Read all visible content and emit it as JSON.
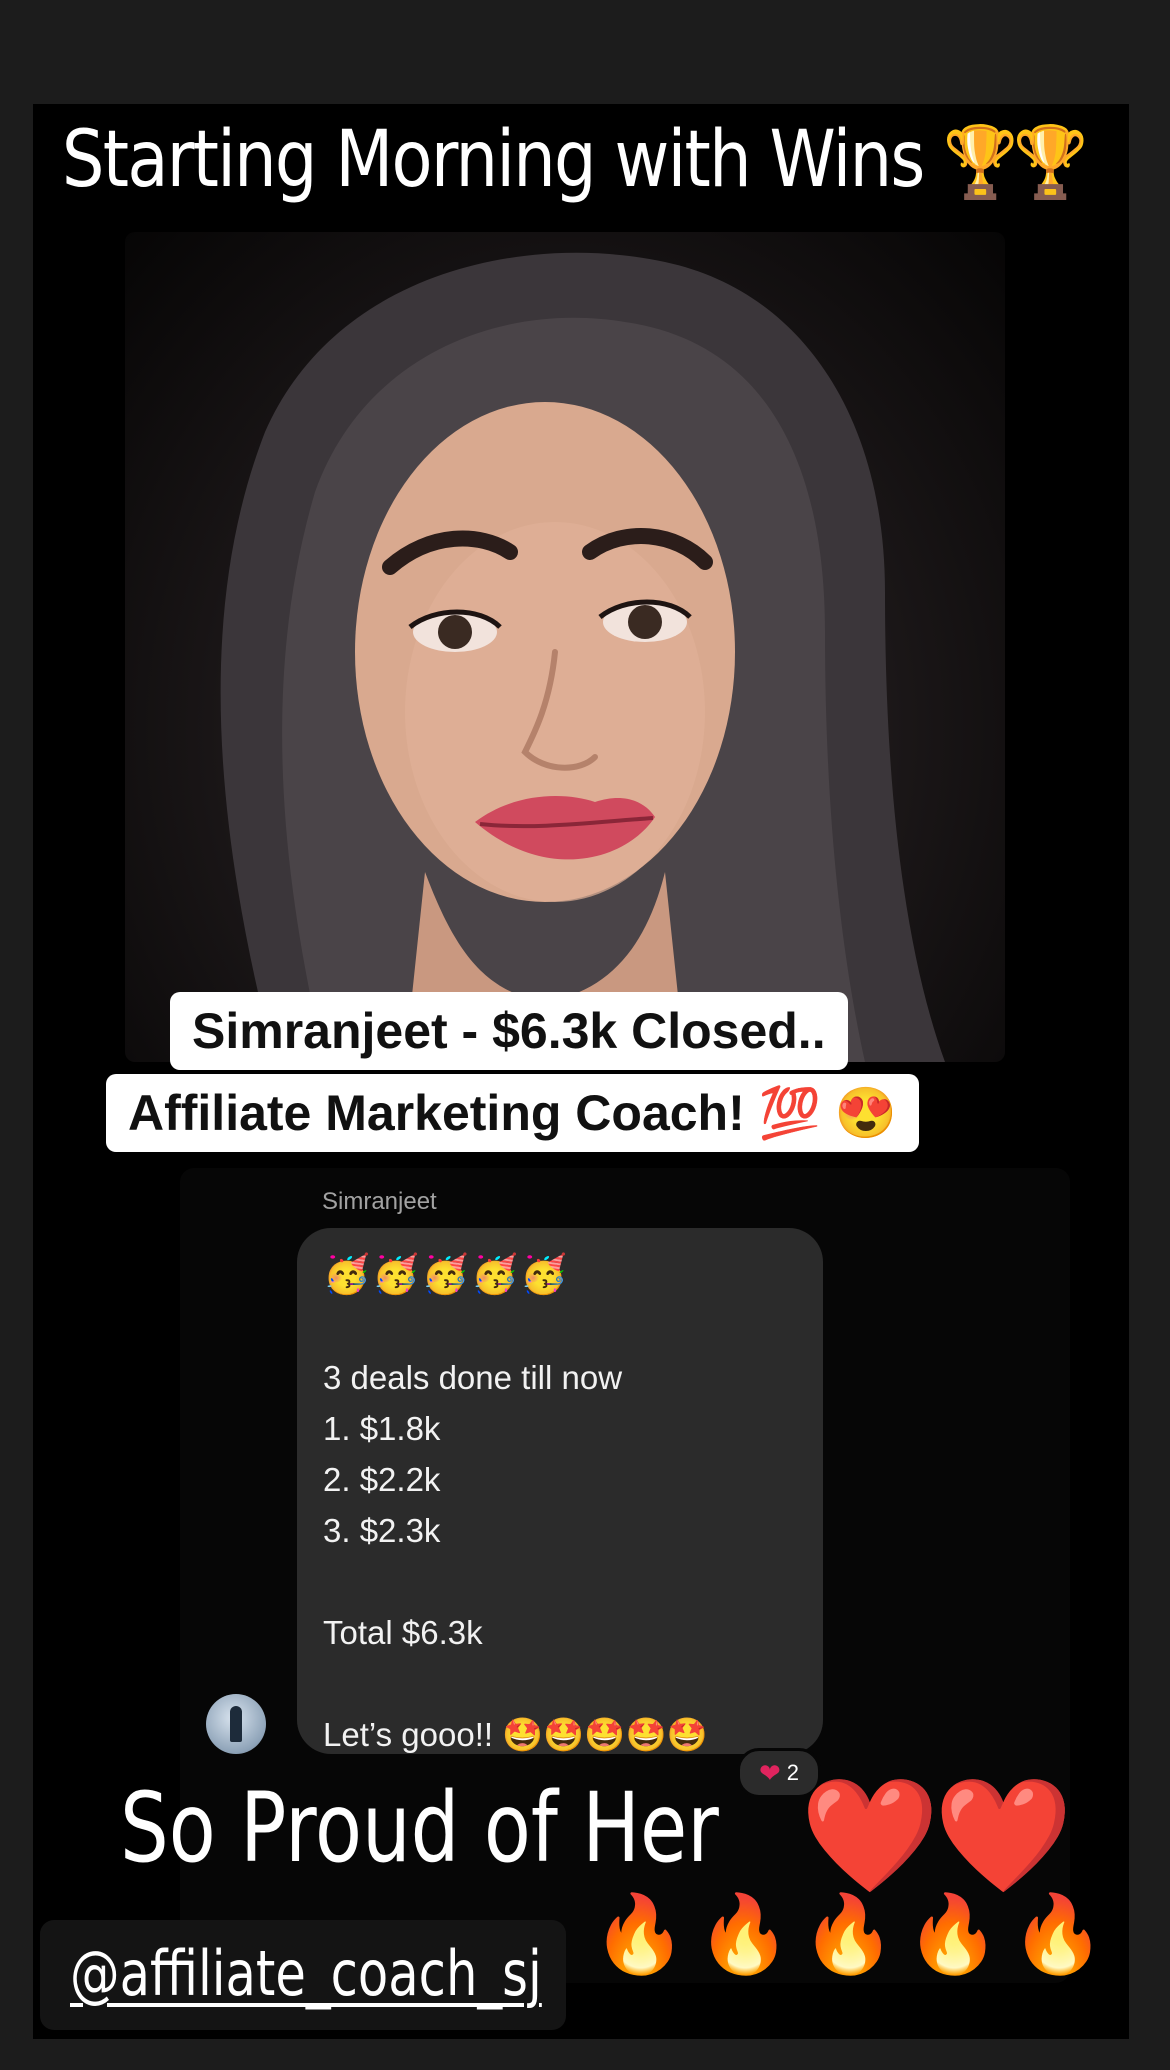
{
  "story": {
    "headline": "Starting Morning with Wins",
    "headline_emoji": "🏆🏆",
    "caption_line1": "Simranjeet - $6.3k Closed..",
    "caption_line2": "Affiliate Marketing Coach! 💯 😍",
    "footer": "So Proud of Her",
    "footer_hearts": "❤️❤️",
    "footer_fire": "🔥🔥🔥🔥🔥",
    "handle": "@affiliate_coach_sj"
  },
  "chat": {
    "sender_name": "Simranjeet",
    "message": {
      "emoji_line": "🥳🥳🥳🥳🥳",
      "intro": "3 deals done till now",
      "deals": [
        "1. $1.8k",
        "2. $2.2k",
        "3. $2.3k"
      ],
      "total": "Total $6.3k",
      "closing": "Let’s gooo!! 🤩🤩🤩🤩🤩"
    },
    "reaction": {
      "emoji": "❤",
      "count": "2"
    }
  },
  "colors": {
    "background": "#000000",
    "bubble": "#2b2b2b",
    "heart": "#e3152b"
  }
}
